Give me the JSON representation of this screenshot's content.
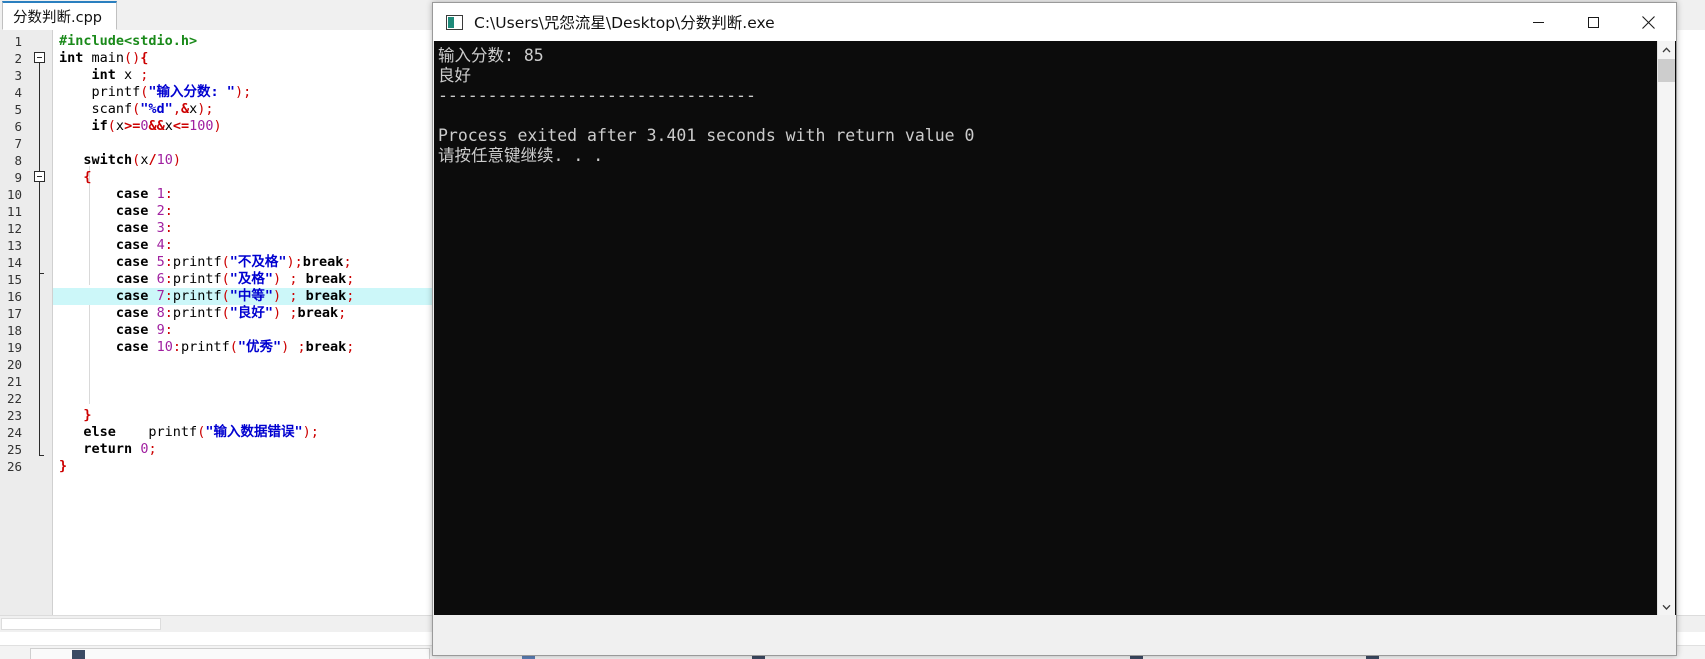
{
  "editor": {
    "tab_label": "分数判断.cpp",
    "highlighted_line": 16,
    "lines": [
      {
        "n": 1,
        "tokens": [
          {
            "t": "pre",
            "s": "#include<stdio.h>"
          }
        ]
      },
      {
        "n": 2,
        "tokens": [
          {
            "t": "kw",
            "s": "int"
          },
          {
            "t": "id",
            "s": " main"
          },
          {
            "t": "punc",
            "s": "()"
          },
          {
            "t": "brace",
            "s": "{"
          }
        ]
      },
      {
        "n": 3,
        "tokens": [
          {
            "t": "id",
            "s": "    "
          },
          {
            "t": "kw",
            "s": "int"
          },
          {
            "t": "id",
            "s": " x "
          },
          {
            "t": "punc",
            "s": ";"
          }
        ]
      },
      {
        "n": 4,
        "tokens": [
          {
            "t": "id",
            "s": "    printf"
          },
          {
            "t": "punc",
            "s": "("
          },
          {
            "t": "str",
            "s": "\"输入分数: \""
          },
          {
            "t": "punc",
            "s": ");"
          }
        ]
      },
      {
        "n": 5,
        "tokens": [
          {
            "t": "id",
            "s": "    scanf"
          },
          {
            "t": "punc",
            "s": "("
          },
          {
            "t": "str",
            "s": "\"%d\""
          },
          {
            "t": "punc",
            "s": ","
          },
          {
            "t": "op",
            "s": "&"
          },
          {
            "t": "id",
            "s": "x"
          },
          {
            "t": "punc",
            "s": ");"
          }
        ]
      },
      {
        "n": 6,
        "tokens": [
          {
            "t": "id",
            "s": "    "
          },
          {
            "t": "kw",
            "s": "if"
          },
          {
            "t": "punc",
            "s": "("
          },
          {
            "t": "id",
            "s": "x"
          },
          {
            "t": "op",
            "s": ">="
          },
          {
            "t": "num",
            "s": "0"
          },
          {
            "t": "op",
            "s": "&&"
          },
          {
            "t": "id",
            "s": "x"
          },
          {
            "t": "op",
            "s": "<="
          },
          {
            "t": "num",
            "s": "100"
          },
          {
            "t": "punc",
            "s": ")"
          }
        ]
      },
      {
        "n": 7,
        "tokens": []
      },
      {
        "n": 8,
        "tokens": [
          {
            "t": "id",
            "s": "   "
          },
          {
            "t": "kw",
            "s": "switch"
          },
          {
            "t": "punc",
            "s": "("
          },
          {
            "t": "id",
            "s": "x"
          },
          {
            "t": "op",
            "s": "/"
          },
          {
            "t": "num",
            "s": "10"
          },
          {
            "t": "punc",
            "s": ")"
          }
        ]
      },
      {
        "n": 9,
        "tokens": [
          {
            "t": "id",
            "s": "   "
          },
          {
            "t": "brace",
            "s": "{"
          }
        ]
      },
      {
        "n": 10,
        "tokens": [
          {
            "t": "id",
            "s": "       "
          },
          {
            "t": "kw",
            "s": "case"
          },
          {
            "t": "id",
            "s": " "
          },
          {
            "t": "num",
            "s": "1"
          },
          {
            "t": "punc",
            "s": ":"
          }
        ]
      },
      {
        "n": 11,
        "tokens": [
          {
            "t": "id",
            "s": "       "
          },
          {
            "t": "kw",
            "s": "case"
          },
          {
            "t": "id",
            "s": " "
          },
          {
            "t": "num",
            "s": "2"
          },
          {
            "t": "punc",
            "s": ":"
          }
        ]
      },
      {
        "n": 12,
        "tokens": [
          {
            "t": "id",
            "s": "       "
          },
          {
            "t": "kw",
            "s": "case"
          },
          {
            "t": "id",
            "s": " "
          },
          {
            "t": "num",
            "s": "3"
          },
          {
            "t": "punc",
            "s": ":"
          }
        ]
      },
      {
        "n": 13,
        "tokens": [
          {
            "t": "id",
            "s": "       "
          },
          {
            "t": "kw",
            "s": "case"
          },
          {
            "t": "id",
            "s": " "
          },
          {
            "t": "num",
            "s": "4"
          },
          {
            "t": "punc",
            "s": ":"
          }
        ]
      },
      {
        "n": 14,
        "tokens": [
          {
            "t": "id",
            "s": "       "
          },
          {
            "t": "kw",
            "s": "case"
          },
          {
            "t": "id",
            "s": " "
          },
          {
            "t": "num",
            "s": "5"
          },
          {
            "t": "punc",
            "s": ":"
          },
          {
            "t": "id",
            "s": "printf"
          },
          {
            "t": "punc",
            "s": "("
          },
          {
            "t": "str",
            "s": "\"不及格\""
          },
          {
            "t": "punc",
            "s": ");"
          },
          {
            "t": "kw",
            "s": "break"
          },
          {
            "t": "punc",
            "s": ";"
          }
        ]
      },
      {
        "n": 15,
        "tokens": [
          {
            "t": "id",
            "s": "       "
          },
          {
            "t": "kw",
            "s": "case"
          },
          {
            "t": "id",
            "s": " "
          },
          {
            "t": "num",
            "s": "6"
          },
          {
            "t": "punc",
            "s": ":"
          },
          {
            "t": "id",
            "s": "printf"
          },
          {
            "t": "punc",
            "s": "("
          },
          {
            "t": "str",
            "s": "\"及格\""
          },
          {
            "t": "punc",
            "s": ")"
          },
          {
            "t": "id",
            "s": " "
          },
          {
            "t": "punc",
            "s": ";"
          },
          {
            "t": "id",
            "s": " "
          },
          {
            "t": "kw",
            "s": "break"
          },
          {
            "t": "punc",
            "s": ";"
          }
        ]
      },
      {
        "n": 16,
        "tokens": [
          {
            "t": "id",
            "s": "       "
          },
          {
            "t": "kw",
            "s": "case"
          },
          {
            "t": "id",
            "s": " "
          },
          {
            "t": "num",
            "s": "7"
          },
          {
            "t": "punc",
            "s": ":"
          },
          {
            "t": "id",
            "s": "printf"
          },
          {
            "t": "punc",
            "s": "("
          },
          {
            "t": "str",
            "s": "\"中等\""
          },
          {
            "t": "punc",
            "s": ")"
          },
          {
            "t": "id",
            "s": " "
          },
          {
            "t": "punc",
            "s": ";"
          },
          {
            "t": "id",
            "s": " "
          },
          {
            "t": "kw",
            "s": "break"
          },
          {
            "t": "punc",
            "s": ";"
          }
        ]
      },
      {
        "n": 17,
        "tokens": [
          {
            "t": "id",
            "s": "       "
          },
          {
            "t": "kw",
            "s": "case"
          },
          {
            "t": "id",
            "s": " "
          },
          {
            "t": "num",
            "s": "8"
          },
          {
            "t": "punc",
            "s": ":"
          },
          {
            "t": "id",
            "s": "printf"
          },
          {
            "t": "punc",
            "s": "("
          },
          {
            "t": "str",
            "s": "\"良好\""
          },
          {
            "t": "punc",
            "s": ")"
          },
          {
            "t": "id",
            "s": " "
          },
          {
            "t": "punc",
            "s": ";"
          },
          {
            "t": "kw",
            "s": "break"
          },
          {
            "t": "punc",
            "s": ";"
          }
        ]
      },
      {
        "n": 18,
        "tokens": [
          {
            "t": "id",
            "s": "       "
          },
          {
            "t": "kw",
            "s": "case"
          },
          {
            "t": "id",
            "s": " "
          },
          {
            "t": "num",
            "s": "9"
          },
          {
            "t": "punc",
            "s": ":"
          }
        ]
      },
      {
        "n": 19,
        "tokens": [
          {
            "t": "id",
            "s": "       "
          },
          {
            "t": "kw",
            "s": "case"
          },
          {
            "t": "id",
            "s": " "
          },
          {
            "t": "num",
            "s": "10"
          },
          {
            "t": "punc",
            "s": ":"
          },
          {
            "t": "id",
            "s": "printf"
          },
          {
            "t": "punc",
            "s": "("
          },
          {
            "t": "str",
            "s": "\"优秀\""
          },
          {
            "t": "punc",
            "s": ")"
          },
          {
            "t": "id",
            "s": " "
          },
          {
            "t": "punc",
            "s": ";"
          },
          {
            "t": "kw",
            "s": "break"
          },
          {
            "t": "punc",
            "s": ";"
          }
        ]
      },
      {
        "n": 20,
        "tokens": []
      },
      {
        "n": 21,
        "tokens": []
      },
      {
        "n": 22,
        "tokens": []
      },
      {
        "n": 23,
        "tokens": [
          {
            "t": "id",
            "s": "   "
          },
          {
            "t": "brace",
            "s": "}"
          }
        ]
      },
      {
        "n": 24,
        "tokens": [
          {
            "t": "id",
            "s": "   "
          },
          {
            "t": "kw",
            "s": "else"
          },
          {
            "t": "id",
            "s": "    printf"
          },
          {
            "t": "punc",
            "s": "("
          },
          {
            "t": "str",
            "s": "\"输入数据错误\""
          },
          {
            "t": "punc",
            "s": ");"
          }
        ]
      },
      {
        "n": 25,
        "tokens": [
          {
            "t": "id",
            "s": "   "
          },
          {
            "t": "kw",
            "s": "return"
          },
          {
            "t": "id",
            "s": " "
          },
          {
            "t": "num",
            "s": "0"
          },
          {
            "t": "punc",
            "s": ";"
          }
        ]
      },
      {
        "n": 26,
        "tokens": [
          {
            "t": "brace",
            "s": "}"
          }
        ]
      }
    ]
  },
  "console": {
    "title": "C:\\Users\\咒怨流星\\Desktop\\分数判断.exe",
    "icon": "console-app-icon",
    "window_controls": {
      "minimize": "minimize-button",
      "maximize": "maximize-button",
      "close": "close-button"
    },
    "output_lines": [
      "输入分数: 85",
      "良好",
      "--------------------------------",
      "",
      "Process exited after 3.401 seconds with return value 0",
      "请按任意键继续. . ."
    ]
  },
  "colors": {
    "console_bg": "#0c0c0c",
    "console_fg": "#cccccc",
    "highlight_line": "#ccf7f9",
    "string_token": "#0000d0",
    "punct_token": "#cc0000",
    "number_token": "#a020a0",
    "preproc_token": "#1a8a1a"
  }
}
